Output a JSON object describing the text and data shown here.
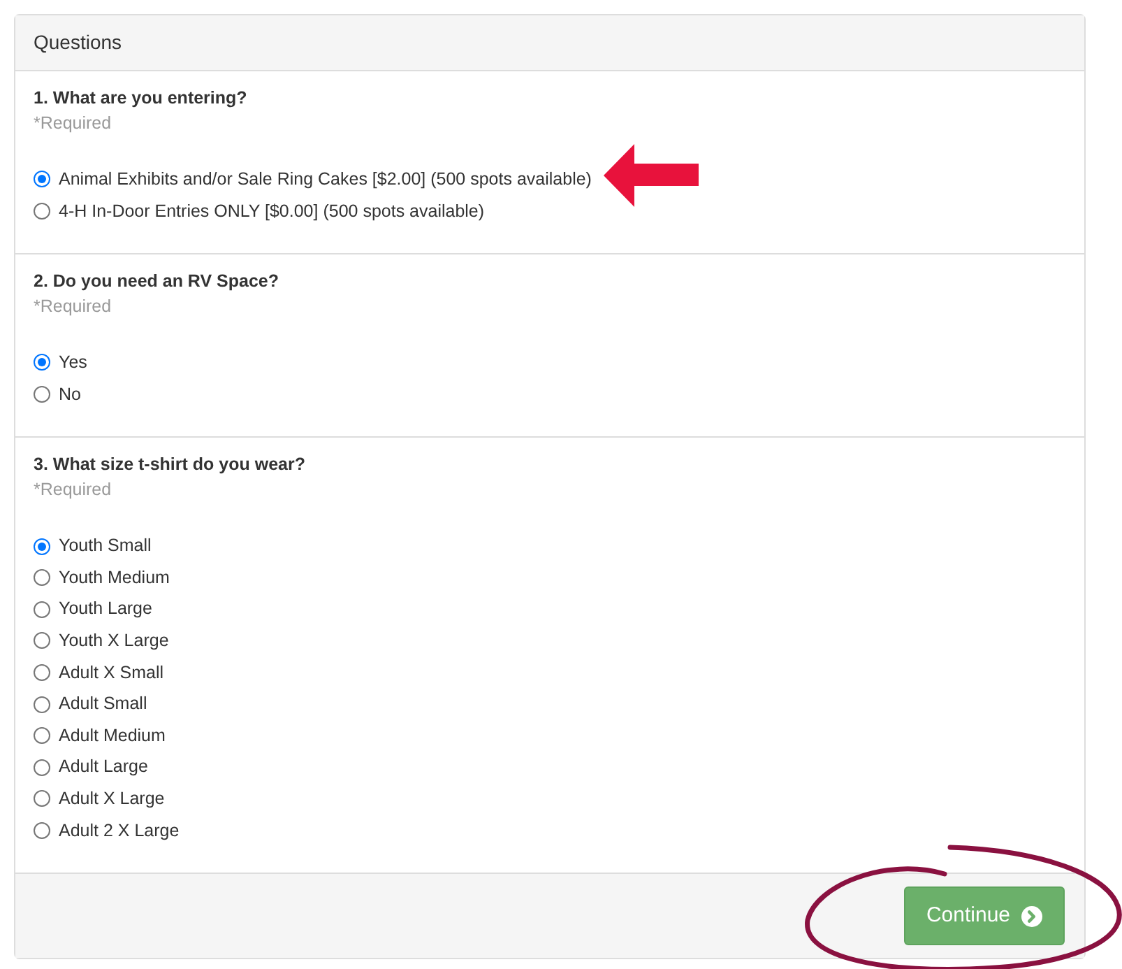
{
  "panel": {
    "title": "Questions"
  },
  "questions": [
    {
      "title": "1. What are you entering?",
      "note": "*Required",
      "options": [
        {
          "label": "Animal Exhibits and/or Sale Ring Cakes [$2.00] (500 spots available)",
          "selected": true
        },
        {
          "label": "4-H In-Door Entries ONLY [$0.00] (500 spots available)",
          "selected": false
        }
      ]
    },
    {
      "title": "2. Do you need an RV Space?",
      "note": "*Required",
      "options": [
        {
          "label": "Yes",
          "selected": true
        },
        {
          "label": "No",
          "selected": false
        }
      ]
    },
    {
      "title": "3. What size t-shirt do you wear?",
      "note": "*Required",
      "options": [
        {
          "label": "Youth Small",
          "selected": true
        },
        {
          "label": "Youth Medium",
          "selected": false
        },
        {
          "label": "Youth Large",
          "selected": false
        },
        {
          "label": "Youth X Large",
          "selected": false
        },
        {
          "label": "Adult X Small",
          "selected": false
        },
        {
          "label": "Adult Small",
          "selected": false
        },
        {
          "label": "Adult Medium",
          "selected": false
        },
        {
          "label": "Adult Large",
          "selected": false
        },
        {
          "label": "Adult X Large",
          "selected": false
        },
        {
          "label": "Adult 2 X Large",
          "selected": false
        }
      ]
    }
  ],
  "footer": {
    "button": "Continue"
  }
}
